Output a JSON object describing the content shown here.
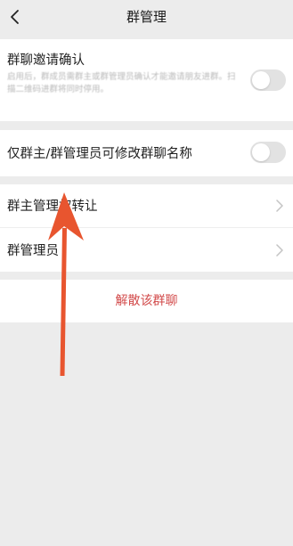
{
  "header": {
    "title": "群管理",
    "back_icon": "chevron-left-icon"
  },
  "settings": {
    "invite_confirm": {
      "label": "群聊邀请确认",
      "description": "启用后，群成员需群主或群管理员确认才能邀请朋友进群。扫描二维码进群将同时停用。",
      "enabled": false
    },
    "rename_restrict": {
      "label": "仅群主/群管理员可修改群聊名称",
      "enabled": false
    },
    "transfer_owner": {
      "label": "群主管理权转让",
      "icon": "chevron-right-icon"
    },
    "admins": {
      "label": "群管理员",
      "icon": "chevron-right-icon"
    },
    "disband": {
      "label": "解散该群聊",
      "color": "#d24a4a"
    }
  },
  "annotation": {
    "type": "arrow",
    "color": "#e8552f",
    "points_to": "transfer_owner"
  }
}
